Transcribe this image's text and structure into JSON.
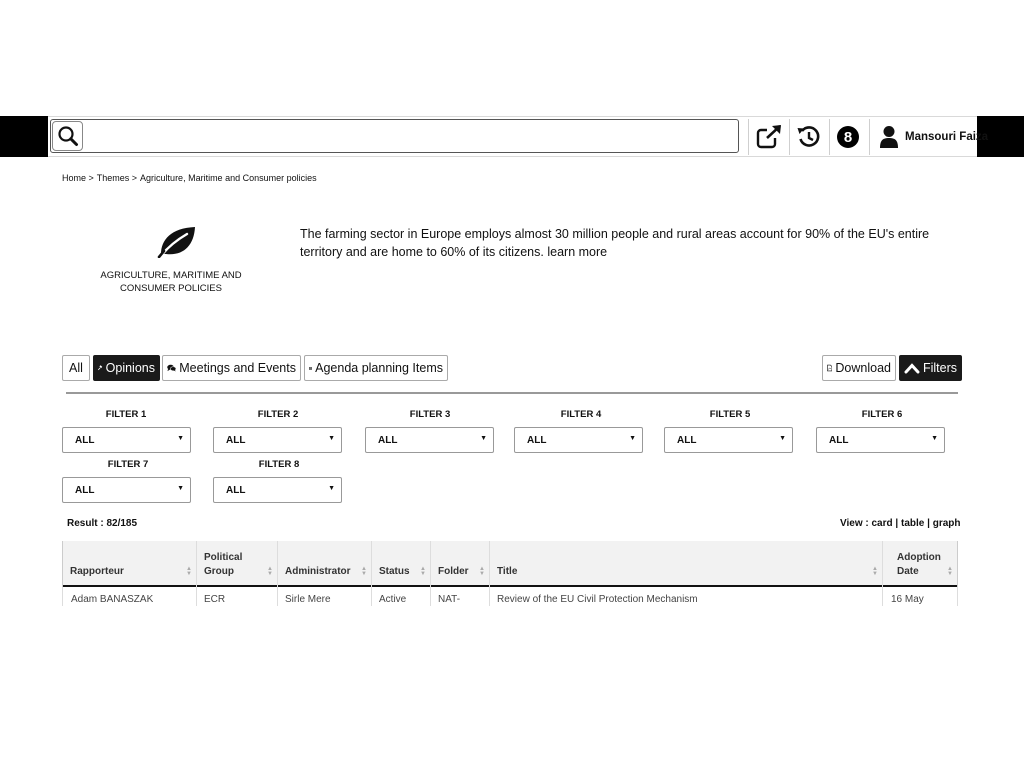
{
  "topbar": {
    "search_placeholder": "",
    "icons": [
      "search-icon",
      "external-link-icon",
      "history-icon",
      "notification-badge",
      "user-icon"
    ],
    "notification_count": "8",
    "user_name": "Mansouri Faiza"
  },
  "breadcrumb": {
    "home": "Home >",
    "themes": "Themes >",
    "current": "Agriculture, Maritime and Consumer policies"
  },
  "theme": {
    "icon": "leaf-icon",
    "title": "AGRICULTURE, MARITIME AND CONSUMER POLICIES",
    "description": "The farming sector in Europe employs almost 30 million people and rural areas account for 90% of the EU's entire territory and are home to 60% of its citizens.",
    "learn_more": "learn more"
  },
  "tabs": {
    "all": "All",
    "opinions": "Opinions",
    "meetings": "Meetings and Events",
    "agenda": "Agenda planning Items",
    "download": "Download",
    "filters": "Filters"
  },
  "filters": [
    {
      "label": "FILTER 1",
      "value": "ALL"
    },
    {
      "label": "FILTER 2",
      "value": "ALL"
    },
    {
      "label": "FILTER 3",
      "value": "ALL"
    },
    {
      "label": "FILTER 4",
      "value": "ALL"
    },
    {
      "label": "FILTER  5",
      "value": "ALL"
    },
    {
      "label": "FILTER  6",
      "value": "ALL"
    },
    {
      "label": "FILTER 7",
      "value": "ALL"
    },
    {
      "label": "FILTER 8",
      "value": "ALL"
    }
  ],
  "results": {
    "text": "Result : 82/185",
    "view_label": "View :",
    "view_card": "card",
    "view_table": "table",
    "view_graph": "graph",
    "sep": "|"
  },
  "table": {
    "headers": [
      "Rapporteur",
      "Political Group",
      "Administrator",
      "Status",
      "Folder",
      "Title",
      "Adoption Date"
    ],
    "row": [
      "Adam BANASZAK",
      "ECR",
      "Sirle Mere",
      "Active",
      "NAT-",
      "Review of the EU Civil Protection Mechanism",
      "16 May"
    ]
  },
  "colors": {
    "dark": "#1a1a1a",
    "header_bg": "#f2f2f2",
    "border": "#999999"
  }
}
